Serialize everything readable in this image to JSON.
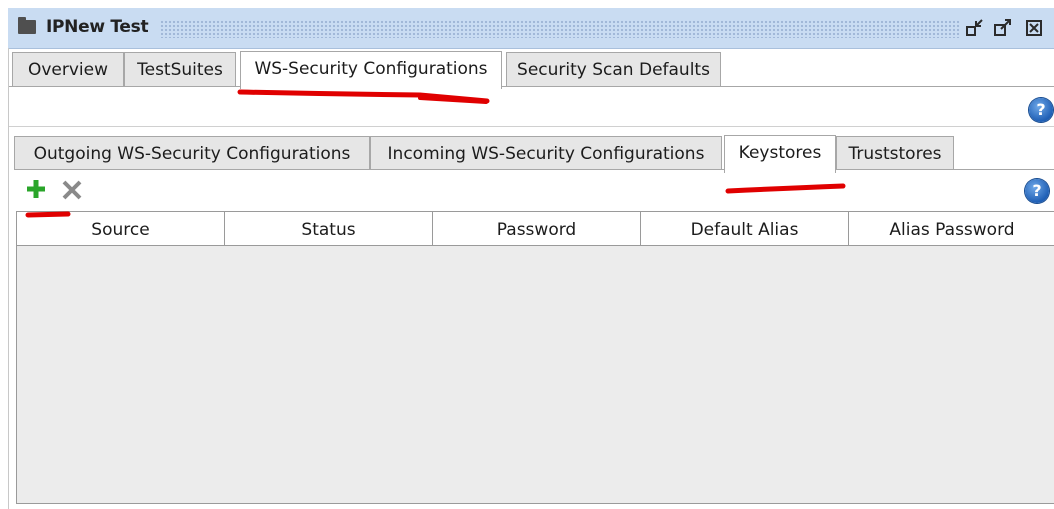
{
  "window": {
    "title": "IPNew Test",
    "icon": "folder-icon",
    "controls": [
      "restore-icon",
      "maximize-icon",
      "close-icon"
    ]
  },
  "top_tabs": [
    {
      "label": "Overview",
      "selected": false
    },
    {
      "label": "TestSuites",
      "selected": false
    },
    {
      "label": "WS-Security Configurations",
      "selected": true
    },
    {
      "label": "Security Scan Defaults",
      "selected": false
    }
  ],
  "inner_tabs": [
    {
      "label": "Outgoing WS-Security Configurations",
      "selected": false
    },
    {
      "label": "Incoming WS-Security Configurations",
      "selected": false
    },
    {
      "label": "Keystores",
      "selected": true
    },
    {
      "label": "Truststores",
      "selected": false
    }
  ],
  "help": {
    "glyph": "?"
  },
  "toolbar": {
    "add_icon": "plus-icon",
    "remove_icon": "x-icon"
  },
  "table": {
    "columns": [
      "Source",
      "Status",
      "Password",
      "Default Alias",
      "Alias Password"
    ],
    "rows": []
  },
  "colors": {
    "titlebar": "#c9dcf2",
    "annotation": "#e00000",
    "add_green": "#2aa52a",
    "help_blue": "#1f5fb5"
  }
}
